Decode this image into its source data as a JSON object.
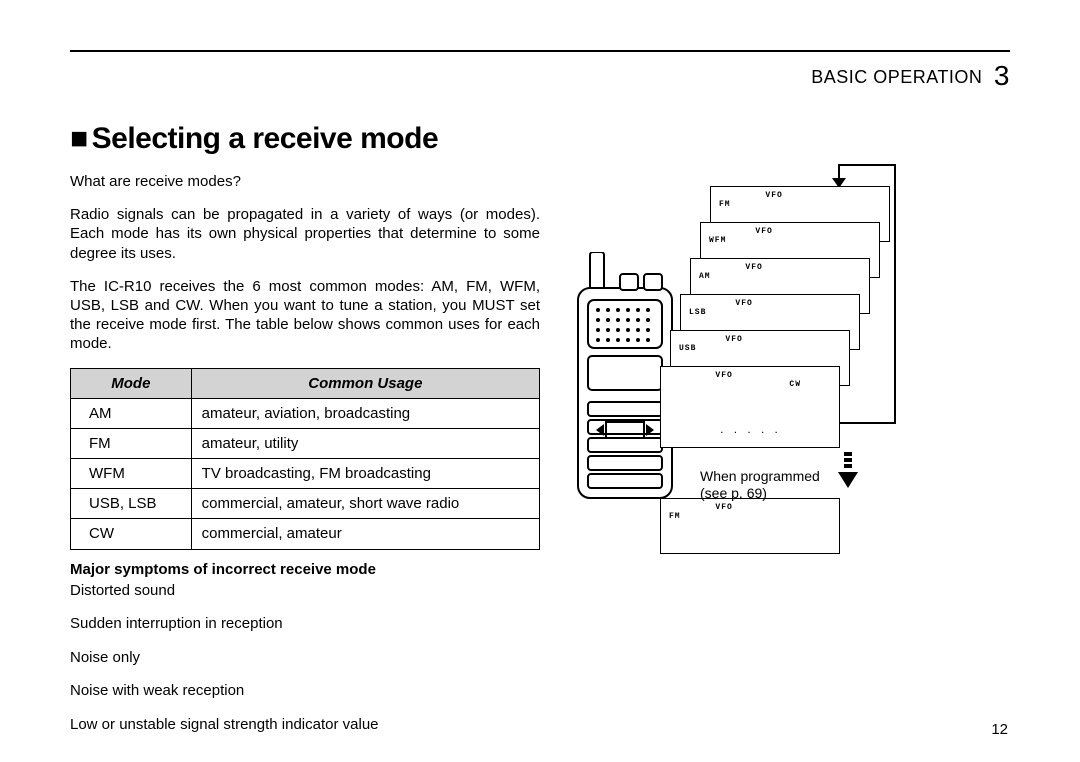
{
  "header": {
    "section": "BASIC OPERATION",
    "chapter": "3"
  },
  "title": "Selecting a receive mode",
  "intro_q": "What are receive modes?",
  "intro_p1": "Radio signals can be propagated in a variety of ways (or modes). Each mode has its own physical properties that determine to some degree its uses.",
  "intro_p2": "The IC-R10 receives the 6 most common modes: AM, FM, WFM, USB, LSB and CW. When you want to tune a station, you MUST set the receive mode first. The table below shows common uses for each mode.",
  "table": {
    "head_mode": "Mode",
    "head_usage": "Common Usage",
    "rows": [
      {
        "mode": "AM",
        "usage": "amateur, aviation, broadcasting"
      },
      {
        "mode": "FM",
        "usage": "amateur, utility"
      },
      {
        "mode": "WFM",
        "usage": "TV broadcasting, FM broadcasting"
      },
      {
        "mode": "USB, LSB",
        "usage": "commercial, amateur, short wave radio"
      },
      {
        "mode": "CW",
        "usage": "commercial, amateur"
      }
    ]
  },
  "symptoms": {
    "title": "Major symptoms of incorrect receive mode",
    "items": [
      "Distorted sound",
      "Sudden interruption in reception",
      "Noise only",
      "Noise with weak reception",
      "Low or unstable signal strength indicator value"
    ]
  },
  "diagram": {
    "vfo_label": "VFO",
    "modes": [
      "FM",
      "WFM",
      "AM",
      "LSB",
      "USB",
      "CW"
    ],
    "caption1": "When programmed",
    "caption2": "(see p. 69)",
    "last_mode": "FM"
  },
  "page_number": "12"
}
